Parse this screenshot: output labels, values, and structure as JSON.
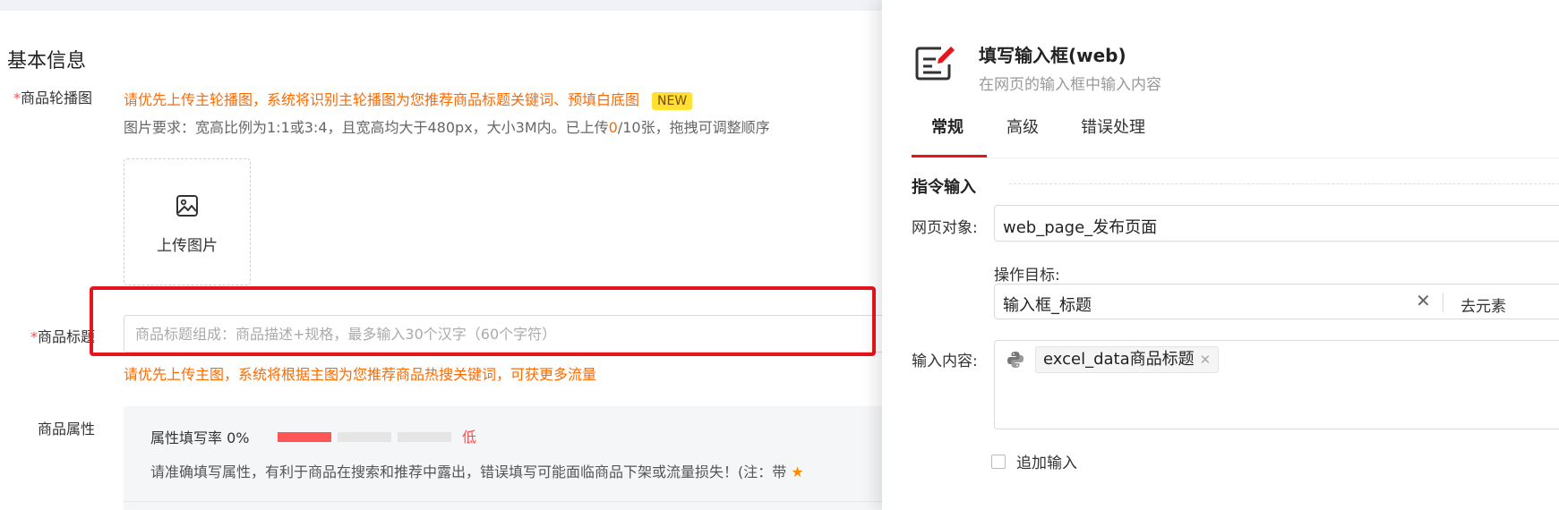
{
  "left": {
    "section_title": "基本信息",
    "carousel": {
      "required_mark": "*",
      "label": "商品轮播图",
      "hint": "请优先上传主轮播图，系统将识别主轮播图为您推荐商品标题关键词、预填白底图",
      "badge": "NEW",
      "req_prefix": "图片要求：宽高比例为1:1或3:4，且宽高均大于480px，大小3M内。已上传",
      "uploaded_count": "0",
      "req_suffix": "/10张，拖拽可调整顺序",
      "upload_label": "上传图片"
    },
    "title_field": {
      "required_mark": "*",
      "label": "商品标题",
      "placeholder": "商品标题组成：商品描述+规格，最多输入30个汉字（60个字符）",
      "hint": "请优先上传主图，系统将根据主图为您推荐商品热搜关键词，可获更多流量"
    },
    "attributes": {
      "label": "商品属性",
      "rate_label": "属性填写率 0%",
      "rate_level": "低",
      "rate_fraction": 0.0,
      "note": "请准确填写属性，有利于商品在搜索和推荐中露出，错误填写可能面临商品下架或流量损失！(注：带",
      "colors": {
        "rate_low": "#ff5555",
        "rate_track": "#e5e5e5"
      }
    }
  },
  "drawer": {
    "icon": "edit-document-icon",
    "title": "填写输入框(web)",
    "subtitle": "在网页的输入框中输入内容",
    "tabs": [
      "常规",
      "高级",
      "错误处理"
    ],
    "active_tab": "常规",
    "group_title": "指令输入",
    "web_object": {
      "label": "网页对象:",
      "value": "web_page_发布页面"
    },
    "target": {
      "label": "操作目标:",
      "value": "输入框_标题",
      "tail_button": "去元素"
    },
    "input_content": {
      "label": "输入内容:",
      "tag": "excel_data商品标题",
      "tag_icon": "python-icon"
    },
    "append_label": "追加输入"
  },
  "colors": {
    "accent": "#e8141b",
    "orange": "#ff6a00",
    "required": "#ff4d4f"
  }
}
